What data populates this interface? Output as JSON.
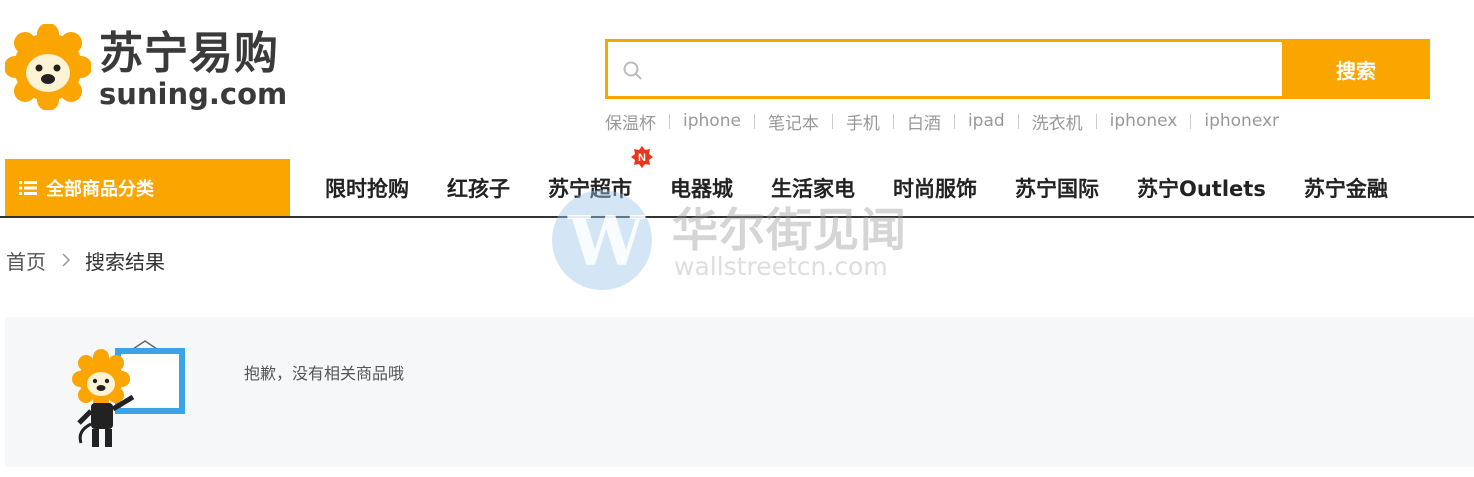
{
  "logo": {
    "name_cn": "苏宁易购",
    "name_en": "suning.com"
  },
  "search": {
    "placeholder": "",
    "value": "",
    "button_label": "搜索",
    "icon": "search-icon"
  },
  "hot_words": [
    "保温杯",
    "iphone",
    "笔记本",
    "手机",
    "白酒",
    "ipad",
    "洗衣机",
    "iphonex",
    "iphonexr"
  ],
  "nav": {
    "all_categories": "全部商品分类",
    "items": [
      "限时抢购",
      "红孩子",
      "苏宁超市",
      "电器城",
      "生活家电",
      "时尚服饰",
      "苏宁国际",
      "苏宁Outlets",
      "苏宁金融"
    ],
    "new_badge": "N"
  },
  "breadcrumb": {
    "home": "首页",
    "current": "搜索结果"
  },
  "result": {
    "message": "抱歉，没有相关商品哦"
  },
  "watermark": {
    "letter": "W",
    "cn": "华尔街见闻",
    "en": "wallstreetcn.com"
  },
  "colors": {
    "brand_orange": "#fba500",
    "search_border": "#f7a600",
    "badge_red": "#e8361c",
    "panel_bg": "#f6f7f9"
  }
}
